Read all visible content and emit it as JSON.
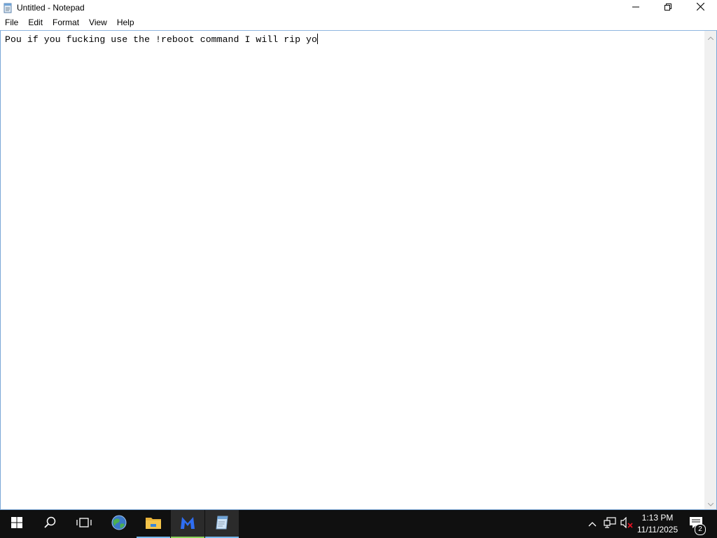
{
  "window": {
    "title": "Untitled - Notepad",
    "icon": "notepad-icon",
    "controls": [
      "minimize-icon",
      "maximize-icon",
      "close-icon"
    ]
  },
  "menu": {
    "items": [
      "File",
      "Edit",
      "Format",
      "View",
      "Help"
    ]
  },
  "editor": {
    "content": "Pou if you fucking use the !reboot command I will rip yo"
  },
  "taskbar": {
    "buttons": [
      "start-icon",
      "search-icon",
      "task-view-icon",
      "browser-icon",
      "file-explorer-icon",
      "malwarebytes-icon",
      "notepad-icon"
    ],
    "tray": {
      "icons": [
        "chevron-up-icon",
        "network-icon",
        "volume-muted-icon"
      ],
      "time": "1:13 PM",
      "date": "11/11/2025",
      "notification_count": "2"
    }
  },
  "colors": {
    "taskbar": "#101010",
    "active_indicator": "#76b9ed",
    "malwarebytes_indicator": "#8bd35b",
    "frame_border": "#7aa7d7"
  }
}
